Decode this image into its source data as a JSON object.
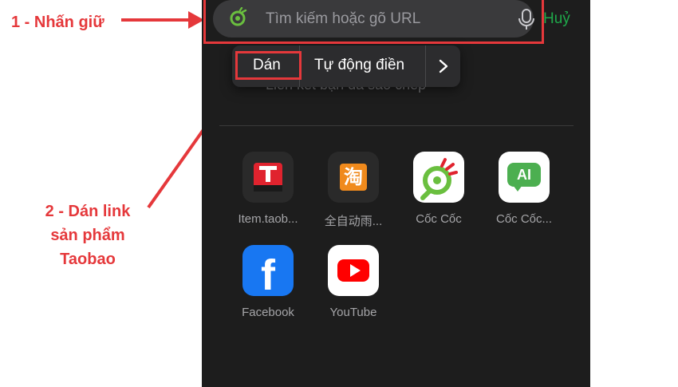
{
  "annotations": {
    "step1": "1 - Nhấn giữ",
    "step2_line1": "2 - Dán link",
    "step2_line2": "sản phẩm",
    "step2_line3": "Taobao",
    "color": "#e5383b"
  },
  "search": {
    "placeholder": "Tìm kiếm hoặc gõ URL",
    "cancel": "Huỷ",
    "icon": "coccoc-icon",
    "mic_icon": "microphone-icon"
  },
  "context_menu": {
    "paste": "Dán",
    "autofill": "Tự động điền",
    "more_icon": "chevron-right-icon"
  },
  "ghost_text": "Liên kết bạn đã sao chép",
  "shortcuts": [
    {
      "label": "Item.taob...",
      "icon": "tmall-t-icon"
    },
    {
      "label": "全自动雨...",
      "icon": "taobao-icon",
      "glyph": "淘"
    },
    {
      "label": "Cốc Cốc",
      "icon": "coccoc-icon"
    },
    {
      "label": "Cốc Cốc...",
      "icon": "coccoc-ai-icon",
      "glyph": "AI"
    },
    {
      "label": "Facebook",
      "icon": "facebook-icon",
      "glyph": "f"
    },
    {
      "label": "YouTube",
      "icon": "youtube-icon"
    }
  ],
  "colors": {
    "background": "#1d1d1d",
    "accent_green": "#1fa84a",
    "annotation_red": "#e5383b"
  }
}
